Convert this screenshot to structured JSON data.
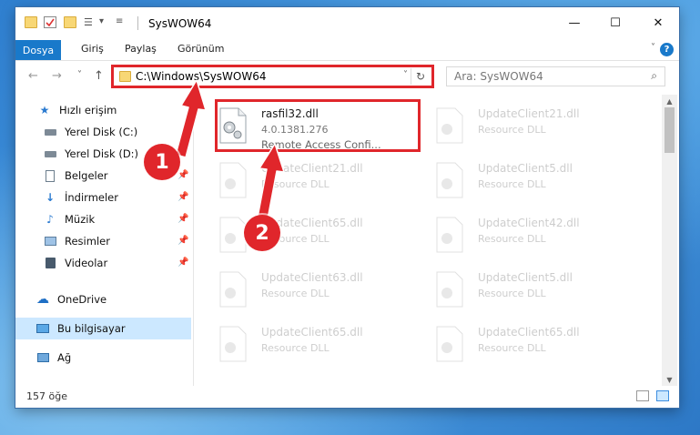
{
  "window": {
    "title": "SysWOW64",
    "buttons": {
      "minimize": "—",
      "maximize": "☐",
      "close": "✕"
    }
  },
  "ribbon": {
    "tabs": [
      "Dosya",
      "Giriş",
      "Paylaş",
      "Görünüm"
    ],
    "help": "?"
  },
  "nav": {
    "back": "←",
    "forward": "→",
    "recent": "˅",
    "up": "↑",
    "address": "C:\\Windows\\SysWOW64",
    "search_placeholder": "Ara: SysWOW64",
    "refresh": "↻"
  },
  "sidebar": {
    "items": [
      {
        "label": "Hızlı erişim",
        "icon": "star-icon"
      },
      {
        "label": "Yerel Disk (C:)",
        "icon": "drive-icon"
      },
      {
        "label": "Yerel Disk (D:)",
        "icon": "drive-icon"
      },
      {
        "label": "Belgeler",
        "icon": "documents-icon"
      },
      {
        "label": "İndirmeler",
        "icon": "downloads-icon"
      },
      {
        "label": "Müzik",
        "icon": "music-icon"
      },
      {
        "label": "Resimler",
        "icon": "pictures-icon"
      },
      {
        "label": "Videolar",
        "icon": "videos-icon"
      },
      {
        "label": "OneDrive",
        "icon": "cloud-icon"
      },
      {
        "label": "Bu bilgisayar",
        "icon": "computer-icon"
      },
      {
        "label": "Ağ",
        "icon": "network-icon"
      }
    ]
  },
  "files": [
    {
      "name": "rasfil32.dll",
      "type": "4.0.1381.276",
      "desc": "Remote Access Confi..."
    },
    {
      "name": "UpdateClient21.dll",
      "type": "Resource DLL"
    },
    {
      "name": "UpdateClient21.dll",
      "type": "Resource DLL"
    },
    {
      "name": "UpdateClient5.dll",
      "type": "Resource DLL"
    },
    {
      "name": "UpdateClient65.dll",
      "type": "Resource DLL"
    },
    {
      "name": "UpdateClient42.dll",
      "type": "Resource DLL"
    },
    {
      "name": "UpdateClient63.dll",
      "type": "Resource DLL"
    },
    {
      "name": "UpdateClient5.dll",
      "type": "Resource DLL"
    },
    {
      "name": "UpdateClient65.dll",
      "type": "Resource DLL"
    },
    {
      "name": "UpdateClient65.dll",
      "type": "Resource DLL"
    }
  ],
  "status": {
    "count": "157 öğe"
  },
  "callouts": [
    "1",
    "2"
  ],
  "colors": {
    "accent": "#1979ca",
    "highlight": "#e0262b",
    "selected": "#cce8ff"
  }
}
